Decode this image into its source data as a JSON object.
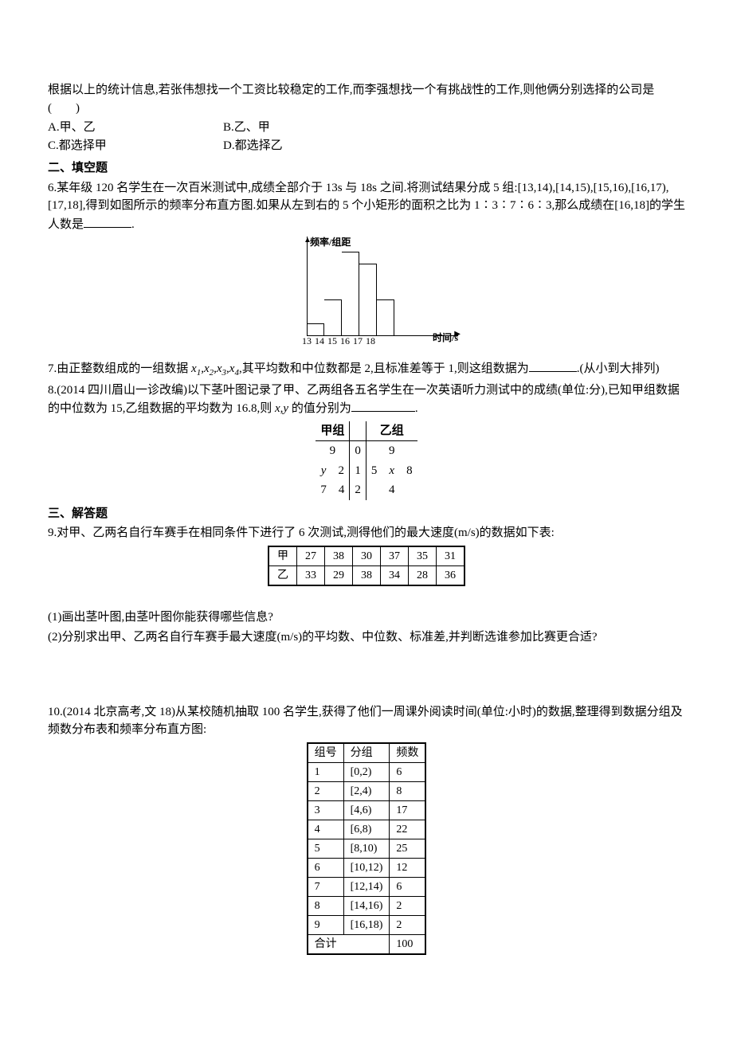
{
  "intro": {
    "line1": "根据以上的统计信息,若张伟想找一个工资比较稳定的工作,而李强想找一个有挑战性的工作,则他俩分别选择的公司是(　　)"
  },
  "q5_options": {
    "a": "A.甲、乙",
    "b": "B.乙、甲",
    "c": "C.都选择甲",
    "d": "D.都选择乙"
  },
  "section2": "二、填空题",
  "q6": {
    "prefix": "6.某年级 120 名学生在一次百米测试中,成绩全部介于 13s 与 18s 之间.将测试结果分成 5 组:[13,14),[14,15),[15,16),[16,17),[17,18],得到如图所示的频率分布直方图.如果从左到右的 5 个小矩形的面积之比为 1∶3∶7∶6∶3,那么成绩在[16,18]的学生人数是",
    "suffix": "."
  },
  "hist": {
    "ylabel": "频率/组距",
    "xlabel": "时间/s",
    "ticks": [
      "13",
      "14",
      "15",
      "16",
      "17",
      "18"
    ]
  },
  "chart_data": {
    "type": "bar",
    "categories": [
      "[13,14)",
      "[14,15)",
      "[15,16)",
      "[16,17)",
      "[17,18]"
    ],
    "values": [
      1,
      3,
      7,
      6,
      3
    ],
    "values_note": "面积比 (area ratio)",
    "xlabel": "时间/s",
    "ylabel": "频率/组距",
    "title": ""
  },
  "q7": {
    "prefix": "7.由正整数组成的一组数据 ",
    "vars": "x₁,x₂,x₃,x₄",
    "mid": ",其平均数和中位数都是 2,且标准差等于 1,则这组数据为",
    "suffix": ".(从小到大排列)"
  },
  "q8": {
    "prefix": "8.(2014 四川眉山一诊改编)以下茎叶图记录了甲、乙两组各五名学生在一次英语听力测试中的成绩(单位:分),已知甲组数据的中位数为 15,乙组数据的平均数为 16.8,则 ",
    "vars": "x,y",
    "mid": " 的值分别为",
    "suffix": "."
  },
  "stemleaf": {
    "head_left": "甲组",
    "head_right": "乙组",
    "rows": [
      {
        "left": "9",
        "stem": "0",
        "right": "9"
      },
      {
        "left": "y　2",
        "stem": "1",
        "right": "5　x　8"
      },
      {
        "left": "7　4",
        "stem": "2",
        "right": "4"
      }
    ]
  },
  "section3": "三、解答题",
  "q9": {
    "stem": "9.对甲、乙两名自行车赛手在相同条件下进行了 6 次测试,测得他们的最大速度(m/s)的数据如下表:",
    "row_jia": "甲",
    "row_yi": "乙",
    "jia": [
      "27",
      "38",
      "30",
      "37",
      "35",
      "31"
    ],
    "yi": [
      "33",
      "29",
      "38",
      "34",
      "28",
      "36"
    ],
    "sub1": "(1)画出茎叶图,由茎叶图你能获得哪些信息?",
    "sub2": "(2)分别求出甲、乙两名自行车赛手最大速度(m/s)的平均数、中位数、标准差,并判断选谁参加比赛更合适?"
  },
  "q10": {
    "stem": "10.(2014 北京高考,文 18)从某校随机抽取 100 名学生,获得了他们一周课外阅读时间(单位:小时)的数据,整理得到数据分组及频数分布表和频率分布直方图:",
    "headers": [
      "组号",
      "分组",
      "频数"
    ],
    "rows": [
      [
        "1",
        "[0,2)",
        "6"
      ],
      [
        "2",
        "[2,4)",
        "8"
      ],
      [
        "3",
        "[4,6)",
        "17"
      ],
      [
        "4",
        "[6,8)",
        "22"
      ],
      [
        "5",
        "[8,10)",
        "25"
      ],
      [
        "6",
        "[10,12)",
        "12"
      ],
      [
        "7",
        "[12,14)",
        "6"
      ],
      [
        "8",
        "[14,16)",
        "2"
      ],
      [
        "9",
        "[16,18)",
        "2"
      ]
    ],
    "total_label": "合计",
    "total_value": "100"
  }
}
